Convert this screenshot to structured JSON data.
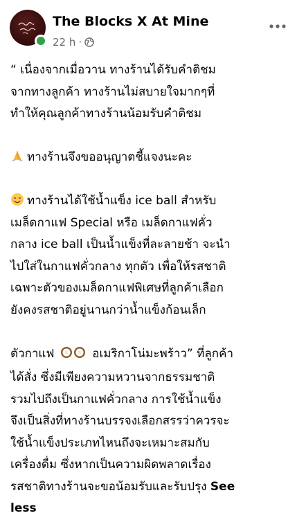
{
  "header": {
    "page_name": "The Blocks X At Mine",
    "time": "22 h",
    "separator": "·",
    "avatar_icon": "brand-logo",
    "privacy_icon": "globe-icon",
    "menu_icon": "more-options-icon",
    "online_color": "#31a24c"
  },
  "post": {
    "paragraphs": [
      {
        "lines": [
          "“ เนื่องจากเมื่อวาน ทางร้านได้รับคำติชม",
          "จากทางลูกค้า ทางร้านไม่สบายใจมากๆที่",
          "ทำให้คุณลูกค้าทางร้านน้อมรับคำติชม"
        ]
      },
      {
        "emoji": "folded-hands-emoji",
        "lines": [
          "ทางร้านจึงขออนุญาตชี้แจงนะคะ"
        ]
      },
      {
        "emoji": "smiling-face-emoji",
        "lines": [
          "ทางร้านได้ใช้น้ำแข็ง ice ball สำหรับ",
          "เมล็ดกาแฟ Special หรือ เมล็ดกาแฟคั่ว",
          "กลาง ice ball เป็นน้ำแข็งที่ละลายช้า จะนำ",
          "ไปใส่ในกาแฟคั่วกลาง ทุกตัว เพื่อให้รสชาติ",
          "เฉพาะตัวของเมล็ดกาแฟพิเศษที่ลูกค้าเลือก",
          "ยังคงรสชาติอยู่นานกว่าน้ำแข็งก้อนเล็ก"
        ]
      },
      {
        "first_line_before": "ตัวกาแฟ",
        "first_line_emoji": "coconut-emoji",
        "first_line_after": "อเมริกาโน่มะพร้าว” ที่ลูกค้า",
        "lines": [
          "ได้สั่ง ซึ่งมีเพียงความหวานจากธรรมชาติ",
          "รวมไปถึงเป็นกาแฟคั่วกลาง การใช้น้ำแข็ง",
          "จึงเป็นสิ่งที่ทางร้านบรรจงเลือกสรรว่าควรจะ",
          "ใช้น้ำแข็งประเภทไหนถึงจะเหมาะสมกับ",
          "เครื่องดื่ม ซึ่งหากเป็นความผิดพลาดเรื่อง"
        ],
        "last_line": "รสชาติทางร้านจะขอน้อมรับและรับปรุง",
        "see_less_line1": "See",
        "see_less_line2": "less"
      }
    ]
  }
}
